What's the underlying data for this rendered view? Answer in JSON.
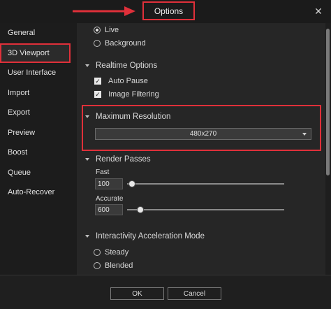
{
  "window": {
    "title": "Options"
  },
  "sidebar": {
    "items": [
      {
        "label": "General"
      },
      {
        "label": "3D Viewport"
      },
      {
        "label": "User Interface"
      },
      {
        "label": "Import"
      },
      {
        "label": "Export"
      },
      {
        "label": "Preview"
      },
      {
        "label": "Boost"
      },
      {
        "label": "Queue"
      },
      {
        "label": "Auto-Recover"
      }
    ],
    "active_index": 1
  },
  "render_mode": {
    "options": [
      {
        "label": "Live",
        "checked": true
      },
      {
        "label": "Background",
        "checked": false
      }
    ]
  },
  "realtime_options": {
    "header": "Realtime Options",
    "auto_pause": {
      "label": "Auto Pause",
      "checked": true
    },
    "image_filtering": {
      "label": "Image Filtering",
      "checked": true
    }
  },
  "maximum_resolution": {
    "header": "Maximum Resolution",
    "selected": "480x270"
  },
  "render_passes": {
    "header": "Render Passes",
    "fast": {
      "label": "Fast",
      "value": "100",
      "slider_fraction": 0.0
    },
    "accurate": {
      "label": "Accurate",
      "value": "600",
      "slider_fraction": 0.06
    }
  },
  "interactivity": {
    "header": "Interactivity Acceleration Mode",
    "options": [
      {
        "label": "Steady",
        "checked": false
      },
      {
        "label": "Blended",
        "checked": false
      }
    ]
  },
  "footer": {
    "ok_label": "OK",
    "cancel_label": "Cancel"
  },
  "colors": {
    "highlight": "#e0303a",
    "background": "#262626"
  }
}
